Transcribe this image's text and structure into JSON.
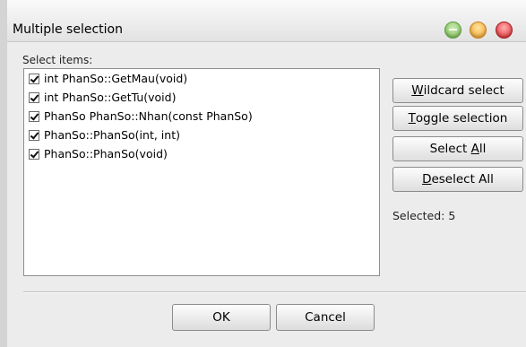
{
  "window": {
    "title": "Multiple selection"
  },
  "list": {
    "label": "Select items:",
    "items": [
      {
        "label": "int PhanSo::GetMau(void)",
        "checked": true
      },
      {
        "label": "int PhanSo::GetTu(void)",
        "checked": true
      },
      {
        "label": "PhanSo PhanSo::Nhan(const PhanSo)",
        "checked": true
      },
      {
        "label": "PhanSo::PhanSo(int, int)",
        "checked": true
      },
      {
        "label": "PhanSo::PhanSo(void)",
        "checked": true
      }
    ]
  },
  "buttons": {
    "wildcard": {
      "mnemonic": "W",
      "rest": "ildcard select"
    },
    "toggle": {
      "mnemonic": "T",
      "rest": "oggle selection"
    },
    "select_all": {
      "pre": "Select ",
      "mnemonic": "A",
      "rest": "ll"
    },
    "deselect_all": {
      "mnemonic": "D",
      "rest": "eselect All"
    },
    "ok": "OK",
    "cancel": "Cancel"
  },
  "status": {
    "selected": "Selected: 5"
  },
  "colors": {
    "minimize": "#7cbf55",
    "maximize": "#f3a227",
    "close": "#e0252b"
  }
}
